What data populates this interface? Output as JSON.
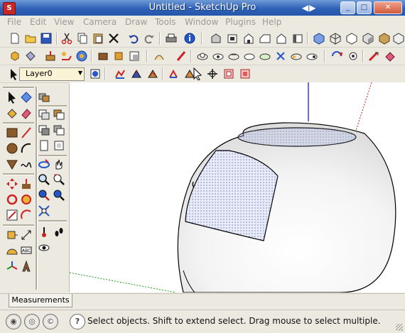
{
  "window": {
    "title": "Untitled - SketchUp Pro",
    "minimize_label": "_",
    "maximize_label": "□",
    "close_label": "✕",
    "nav_arrows": "◀▶"
  },
  "menu": [
    "File",
    "Edit",
    "View",
    "Camera",
    "Draw",
    "Tools",
    "Window",
    "Plugins",
    "Help"
  ],
  "layer": {
    "current": "Layer0"
  },
  "measurements": {
    "label": "Measurements"
  },
  "status": {
    "message": "Select objects. Shift to extend select. Drag mouse to select multiple.",
    "help_glyph": "?"
  },
  "colors": {
    "title_bar": "#2f62b8",
    "menu_text_disabled": "#9a9a9a",
    "sphere_fill": "#e9e9e9",
    "blue_axis": "#1a1ad6",
    "red_axis": "#d01c1c",
    "green_axis": "#1a9a1a",
    "layer_field": "#fbf3d6"
  }
}
